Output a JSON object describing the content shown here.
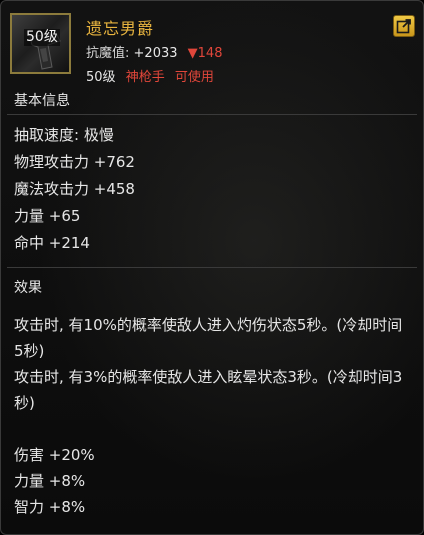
{
  "item": {
    "level_badge": "50级",
    "name": "遗忘男爵",
    "resist_label": "抗魔值:",
    "resist_value": "+2033",
    "resist_change": "▼148",
    "req_level": "50级",
    "req_class": "神枪手",
    "req_usable": "可使用"
  },
  "basic": {
    "title": "基本信息",
    "stats": [
      "抽取速度: 极慢",
      "物理攻击力 +762",
      "魔法攻击力 +458",
      "力量 +65",
      "命中 +214"
    ]
  },
  "effects": {
    "title": "效果",
    "descriptions": [
      "攻击时, 有10%的概率使敌人进入灼伤状态5秒。(冷却时间5秒)",
      "攻击时, 有3%的概率使敌人进入眩晕状态3秒。(冷却时间3秒)"
    ],
    "bonuses": [
      "伤害 +20%",
      "力量 +8%",
      "智力 +8%"
    ]
  },
  "colors": {
    "name": "#e8b43f",
    "negative": "#e0463a",
    "frame": "#8c7b3c"
  },
  "icons": {
    "link": "share-link-icon"
  }
}
